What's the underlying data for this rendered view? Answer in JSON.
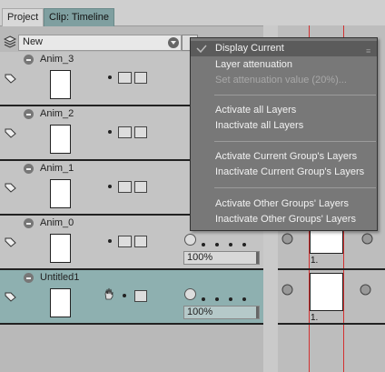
{
  "tabs": [
    {
      "label": "Project",
      "active": false
    },
    {
      "label": "Clip: Timeline",
      "active": true
    }
  ],
  "toolbar": {
    "layer_dropdown_value": "New",
    "layers_icon": "layers-icon",
    "mode_icon": "toggle-icon"
  },
  "layers": [
    {
      "name": "Anim_3",
      "opacity": "",
      "selected": false
    },
    {
      "name": "Anim_2",
      "opacity": "",
      "selected": false
    },
    {
      "name": "Anim_1",
      "opacity": "",
      "selected": false
    },
    {
      "name": "Anim_0",
      "opacity": "100%",
      "selected": false
    },
    {
      "name": "Untitled1",
      "opacity": "100%",
      "selected": true
    }
  ],
  "timeline": {
    "cel_labels": [
      "1.",
      "1."
    ]
  },
  "context_menu": {
    "items": [
      {
        "label": "Display Current",
        "state": "highlighted"
      },
      {
        "label": "Layer attenuation",
        "state": "normal"
      },
      {
        "label": "Set attenuation value (20%)...",
        "state": "disabled"
      },
      {
        "label": "Activate all Layers",
        "state": "normal"
      },
      {
        "label": "Inactivate all Layers",
        "state": "normal"
      },
      {
        "label": "Activate Current Group's Layers",
        "state": "normal"
      },
      {
        "label": "Inactivate Current Group's Layers",
        "state": "normal"
      },
      {
        "label": "Activate Other Groups' Layers",
        "state": "normal"
      },
      {
        "label": "Inactivate Other Groups' Layers",
        "state": "normal"
      }
    ]
  },
  "colors": {
    "selected_row": "#8eb0b0",
    "active_tab": "#7f9fa0",
    "menu_bg": "#787878",
    "playhead": "#d23030"
  }
}
